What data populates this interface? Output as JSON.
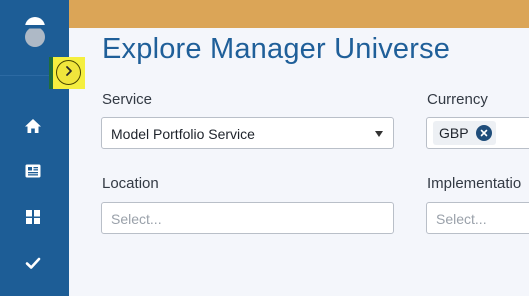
{
  "app": {
    "brand_icon": "logo-icon",
    "accent_color": "#1d5d96",
    "topbar_color": "#dba557"
  },
  "sidebar": {
    "toggle_icon": "chevron-right-icon",
    "items": [
      {
        "icon": "home-icon"
      },
      {
        "icon": "newspaper-icon"
      },
      {
        "icon": "dashboard-icon"
      },
      {
        "icon": "check-icon"
      }
    ]
  },
  "page": {
    "title": "Explore Manager Universe"
  },
  "filters": {
    "service": {
      "label": "Service",
      "value": "Model Portfolio Service"
    },
    "currency": {
      "label": "Currency",
      "chips": [
        "GBP"
      ]
    },
    "location": {
      "label": "Location",
      "placeholder": "Select..."
    },
    "implementation": {
      "label": "Implementatio",
      "placeholder": "Select..."
    }
  }
}
